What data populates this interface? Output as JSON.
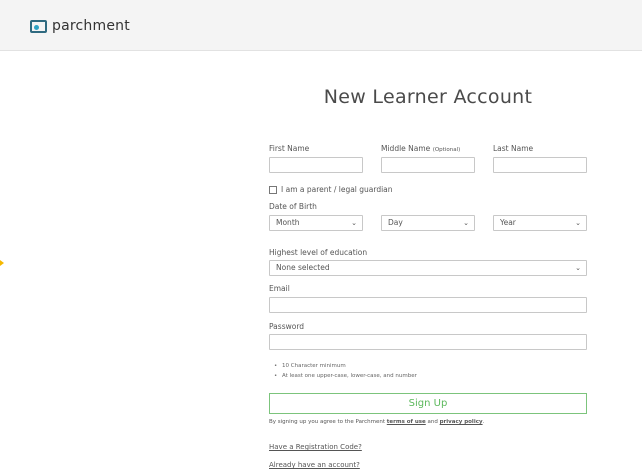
{
  "brand": {
    "name": "parchment"
  },
  "page": {
    "title": "New Learner Account"
  },
  "form": {
    "first_name_label": "First Name",
    "middle_name_label": "Middle Name",
    "middle_name_optional": "(Optional)",
    "last_name_label": "Last Name",
    "parent_checkbox_label": "I am a parent / legal guardian",
    "dob_label": "Date of Birth",
    "month_value": "Month",
    "day_value": "Day",
    "year_value": "Year",
    "education_label": "Highest level of education",
    "education_value": "None selected",
    "email_label": "Email",
    "password_label": "Password",
    "password_rules": [
      "10 Character minimum",
      "At least one upper-case, lower-case, and number"
    ],
    "signup_label": "Sign Up",
    "agree_prefix": "By signing up you agree to the Parchment",
    "terms_link": "terms of use",
    "agree_and": "and",
    "privacy_link": "privacy policy",
    "agree_suffix": ".",
    "registration_code_link": "Have a Registration Code?",
    "existing_account_link": "Already have an account?"
  },
  "colors": {
    "accent_green": "#5cb85c",
    "logo_blue": "#2f6a80",
    "cursor_marker": "#f5b800"
  }
}
